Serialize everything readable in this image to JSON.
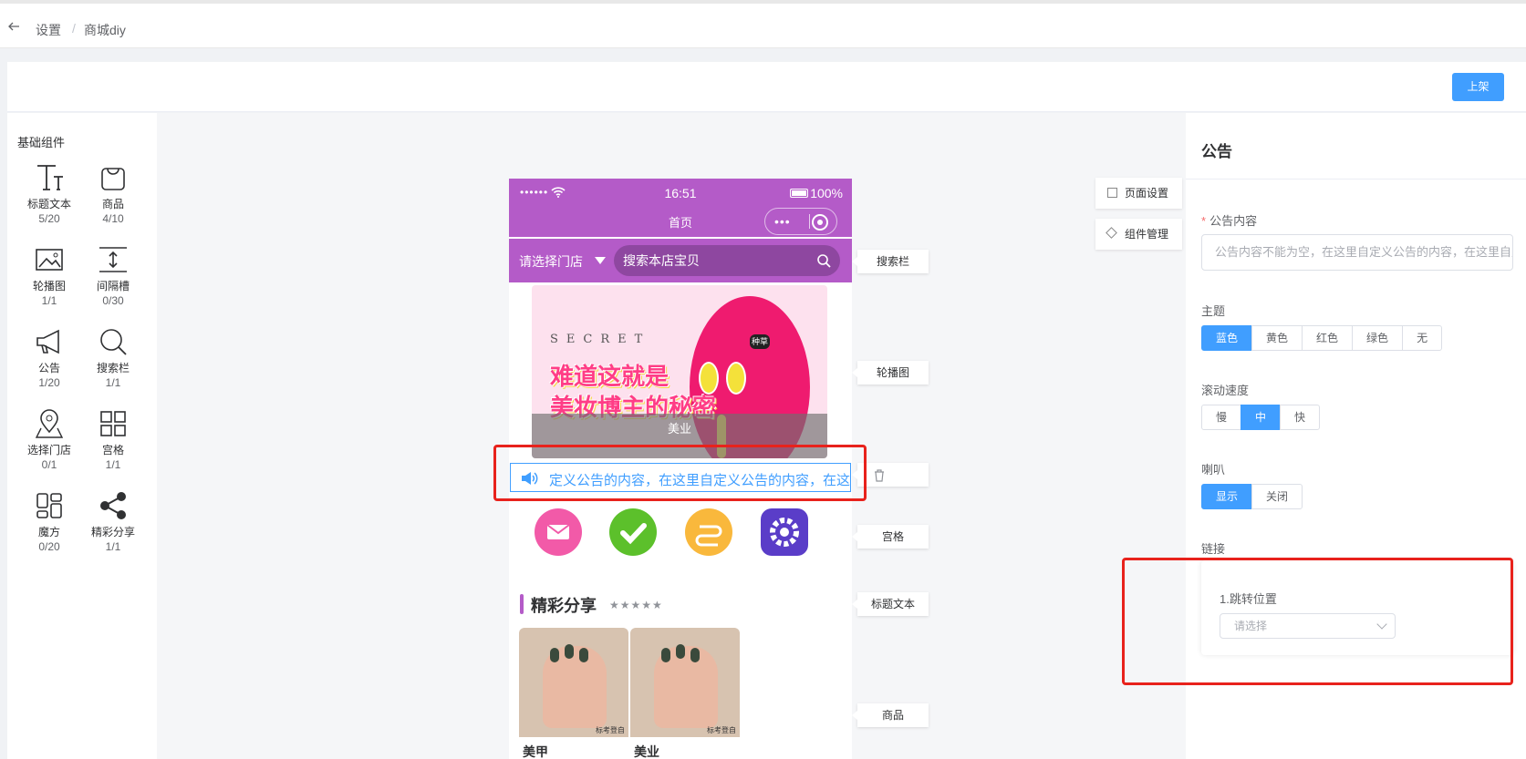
{
  "breadcrumb": {
    "level1": "设置",
    "sep": "/",
    "level2": "商城diy"
  },
  "toolbar": {
    "publish_label": "上架"
  },
  "components": {
    "title": "基础组件",
    "items": [
      {
        "name": "标题文本",
        "count": "5/20",
        "icon": "text-icon"
      },
      {
        "name": "商品",
        "count": "4/10",
        "icon": "bag-icon"
      },
      {
        "name": "轮播图",
        "count": "1/1",
        "icon": "image-icon"
      },
      {
        "name": "间隔槽",
        "count": "0/30",
        "icon": "spacer-icon"
      },
      {
        "name": "公告",
        "count": "1/20",
        "icon": "megaphone-icon"
      },
      {
        "name": "搜索栏",
        "count": "1/1",
        "icon": "search-icon"
      },
      {
        "name": "选择门店",
        "count": "0/1",
        "icon": "map-pin-icon"
      },
      {
        "name": "宫格",
        "count": "1/1",
        "icon": "grid-icon"
      },
      {
        "name": "魔方",
        "count": "0/20",
        "icon": "layout-icon"
      },
      {
        "name": "精彩分享",
        "count": "1/1",
        "icon": "share-icon"
      }
    ]
  },
  "phone": {
    "signal": "••••••",
    "time": "16:51",
    "battery": "100%",
    "page_title": "首页",
    "capsule_dots": "•••",
    "store_label": "请选择门店",
    "search_placeholder": "搜索本店宝贝",
    "banner": {
      "secret": "SECRET",
      "line1": "难道这就是",
      "line2": "美妆博主的秘密",
      "tag": "种草",
      "caption": "美业"
    },
    "notice_text": "定义公告的内容，在这里自定义公告的内容，在这里自定义公告的内容",
    "section_title": "精彩分享",
    "section_stars": "★★★★★",
    "goods": [
      {
        "name": "美甲",
        "watermark": "标考登自"
      },
      {
        "name": "美业",
        "watermark": "标考登自"
      }
    ]
  },
  "canvas_tags": {
    "search": "搜索栏",
    "banner": "轮播图",
    "grid": "宫格",
    "title_text": "标题文本",
    "goods": "商品"
  },
  "side_buttons": {
    "page_settings": "页面设置",
    "component_manage": "组件管理"
  },
  "settings": {
    "title": "公告",
    "content_label": "公告内容",
    "content_placeholder": "公告内容不能为空，在这里自定义公告的内容，在这里自定义公告的内容",
    "theme_label": "主题",
    "theme_options": [
      "蓝色",
      "黄色",
      "红色",
      "绿色",
      "无"
    ],
    "theme_selected": "蓝色",
    "speed_label": "滚动速度",
    "speed_options": [
      "慢",
      "中",
      "快"
    ],
    "speed_selected": "中",
    "horn_label": "喇叭",
    "horn_options": [
      "显示",
      "关闭"
    ],
    "horn_selected": "显示",
    "link_label": "链接",
    "jump_label": "1.跳转位置",
    "jump_placeholder": "请选择"
  },
  "colors": {
    "accent": "#409eff",
    "phone_theme": "#b45bc8",
    "highlight": "#e8221c"
  }
}
